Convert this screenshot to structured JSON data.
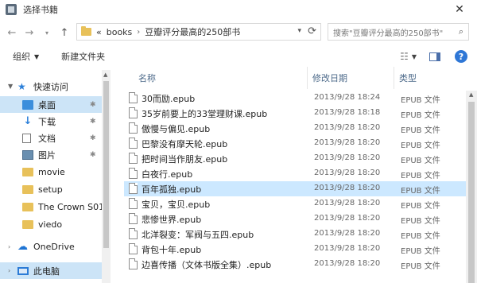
{
  "window": {
    "title": "选择书籍",
    "close_label": "✕"
  },
  "address": {
    "prefix": "«",
    "crumbs": [
      "books",
      "豆瓣评分最高的250部书"
    ],
    "separator": "›"
  },
  "search": {
    "placeholder": "搜索\"豆瓣评分最高的250部书\""
  },
  "toolbar": {
    "organize_label": "组织",
    "new_folder_label": "新建文件夹"
  },
  "nav": {
    "quick_access": "快速访问",
    "items": [
      {
        "label": "桌面",
        "icon": "desktop-icon",
        "pinned": true,
        "selected": true
      },
      {
        "label": "下载",
        "icon": "download-icon",
        "pinned": true
      },
      {
        "label": "文档",
        "icon": "document-icon",
        "pinned": true
      },
      {
        "label": "图片",
        "icon": "picture-icon",
        "pinned": true
      },
      {
        "label": "movie",
        "icon": "folder-icon"
      },
      {
        "label": "setup",
        "icon": "folder-icon"
      },
      {
        "label": "The Crown S01",
        "icon": "folder-icon"
      },
      {
        "label": "viedo",
        "icon": "folder-icon"
      }
    ],
    "onedrive": "OneDrive",
    "this_pc": "此电脑"
  },
  "columns": {
    "name": "名称",
    "date": "修改日期",
    "type": "类型"
  },
  "files": [
    {
      "name": "30而励.epub",
      "date": "2013/9/28 18:24",
      "type": "EPUB 文件"
    },
    {
      "name": "35岁前要上的33堂理财课.epub",
      "date": "2013/9/28 18:18",
      "type": "EPUB 文件"
    },
    {
      "name": "傲慢与偏见.epub",
      "date": "2013/9/28 18:20",
      "type": "EPUB 文件"
    },
    {
      "name": "巴黎没有摩天轮.epub",
      "date": "2013/9/28 18:20",
      "type": "EPUB 文件"
    },
    {
      "name": "把时间当作朋友.epub",
      "date": "2013/9/28 18:20",
      "type": "EPUB 文件"
    },
    {
      "name": "白夜行.epub",
      "date": "2013/9/28 18:20",
      "type": "EPUB 文件"
    },
    {
      "name": "百年孤独.epub",
      "date": "2013/9/28 18:20",
      "type": "EPUB 文件",
      "selected": true
    },
    {
      "name": "宝贝，宝贝.epub",
      "date": "2013/9/28 18:20",
      "type": "EPUB 文件"
    },
    {
      "name": "悲惨世界.epub",
      "date": "2013/9/28 18:20",
      "type": "EPUB 文件"
    },
    {
      "name": "北洋裂变：军阀与五四.epub",
      "date": "2013/9/28 18:20",
      "type": "EPUB 文件"
    },
    {
      "name": "背包十年.epub",
      "date": "2013/9/28 18:20",
      "type": "EPUB 文件"
    },
    {
      "name": "边喜传播（文体书版全集）.epub",
      "date": "2013/9/28 18:20",
      "type": "EPUB 文件"
    }
  ]
}
